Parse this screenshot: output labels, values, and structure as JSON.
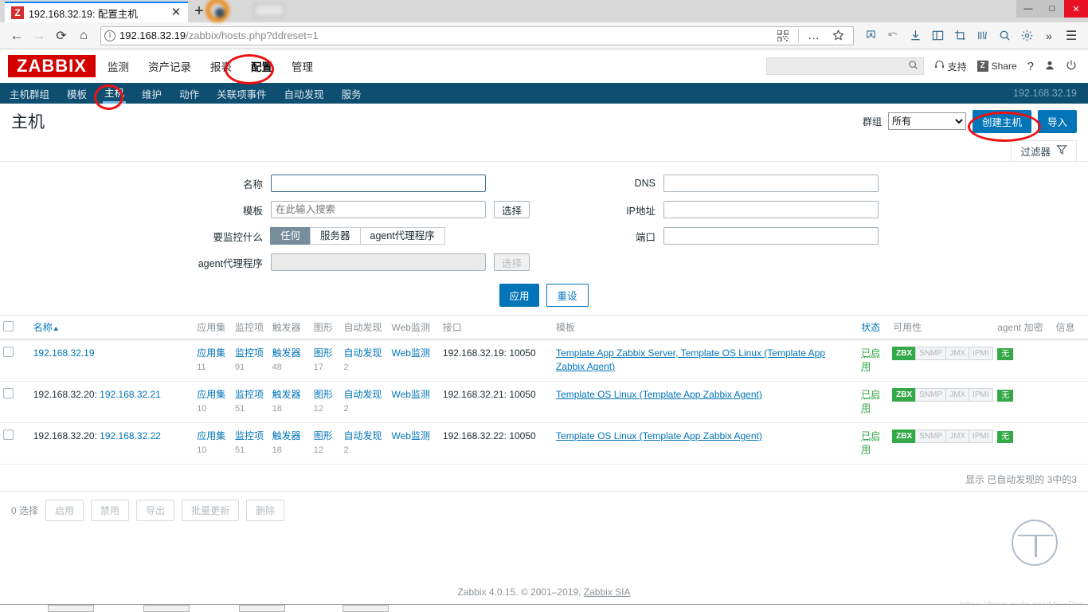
{
  "browser": {
    "tab": {
      "favicon_letter": "Z",
      "title": "192.168.32.19: 配置主机",
      "close": "✕"
    },
    "newtab_label": "+",
    "window_controls": {
      "minimize": "—",
      "maximize": "□",
      "close": "✕"
    },
    "nav": {
      "back": "←",
      "forward": "→",
      "reload": "⟳",
      "home": "⌂"
    },
    "url": {
      "scheme_host": "192.168.32.19",
      "path": "/zabbix/hosts.php?ddreset=1"
    },
    "toolbar_icons": [
      "qr-code-icon",
      "more-icon",
      "star-icon",
      "pocket-icon",
      "undo-icon",
      "download-icon",
      "sidebar-icon",
      "screenshot-icon",
      "library-icon",
      "search-icon",
      "settings-icon",
      "overflow-icon",
      "menu-icon"
    ]
  },
  "zabbix": {
    "logo": "ZABBIX",
    "main_menu": [
      {
        "label": "监测",
        "selected": false
      },
      {
        "label": "资产记录",
        "selected": false
      },
      {
        "label": "报表",
        "selected": false
      },
      {
        "label": "配置",
        "selected": true
      },
      {
        "label": "管理",
        "selected": false
      }
    ],
    "header_right": {
      "search_value": "",
      "support": "支持",
      "share": "Share",
      "share_badge": "Z",
      "help": "?",
      "user_icon": "user-icon",
      "signout_icon": "power-icon"
    },
    "sub_menu": [
      {
        "label": "主机群组",
        "selected": false
      },
      {
        "label": "模板",
        "selected": false
      },
      {
        "label": "主机",
        "selected": true
      },
      {
        "label": "维护",
        "selected": false
      },
      {
        "label": "动作",
        "selected": false
      },
      {
        "label": "关联项事件",
        "selected": false
      },
      {
        "label": "自动发现",
        "selected": false
      },
      {
        "label": "服务",
        "selected": false
      }
    ],
    "server_ip": "192.168.32.19"
  },
  "page": {
    "title": "主机",
    "group_label": "群组",
    "group_selected": "所有",
    "group_options": [
      "所有"
    ],
    "create_host_button": "创建主机",
    "import_button": "导入",
    "filter_tab_label": "过滤器"
  },
  "filter": {
    "left": {
      "name_label": "名称",
      "name_value": "",
      "template_label": "模板",
      "template_value": "",
      "template_placeholder": "在此输入搜索",
      "template_select_button": "选择",
      "monitored_by_label": "要监控什么",
      "monitored_by_options": [
        {
          "label": "任何",
          "selected": true
        },
        {
          "label": "服务器",
          "selected": false
        },
        {
          "label": "agent代理程序",
          "selected": false
        }
      ],
      "proxy_label": "agent代理程序",
      "proxy_value": "",
      "proxy_select_button": "选择"
    },
    "right": {
      "dns_label": "DNS",
      "dns_value": "",
      "ip_label": "IP地址",
      "ip_value": "",
      "port_label": "端口",
      "port_value": ""
    },
    "apply_button": "应用",
    "reset_button": "重设"
  },
  "table": {
    "columns": [
      "名称",
      "应用集",
      "监控项",
      "触发器",
      "图形",
      "自动发现",
      "Web监测",
      "接口",
      "模板",
      "状态",
      "可用性",
      "agent 加密",
      "信息"
    ],
    "sort_indicator": "▲",
    "rows": [
      {
        "checked": false,
        "prefix": "",
        "name": "192.168.32.19",
        "applications": {
          "label": "应用集",
          "count": "11"
        },
        "items": {
          "label": "监控项",
          "count": "91"
        },
        "triggers": {
          "label": "触发器",
          "count": "48"
        },
        "graphs": {
          "label": "图形",
          "count": "17"
        },
        "discovery": {
          "label": "自动发现",
          "count": "2"
        },
        "web": {
          "label": "Web监测",
          "count": ""
        },
        "interface": "192.168.32.19: 10050",
        "templates": "Template App Zabbix Server, Template OS Linux (Template App Zabbix Agent)",
        "status": "已启用",
        "availability": [
          {
            "label": "ZBX",
            "on": true
          },
          {
            "label": "SNMP",
            "on": false
          },
          {
            "label": "JMX",
            "on": false
          },
          {
            "label": "IPMI",
            "on": false
          }
        ],
        "encryption": "无",
        "info": ""
      },
      {
        "checked": false,
        "prefix": "192.168.32.20:",
        "name": "192.168.32.21",
        "applications": {
          "label": "应用集",
          "count": "10"
        },
        "items": {
          "label": "监控项",
          "count": "51"
        },
        "triggers": {
          "label": "触发器",
          "count": "18"
        },
        "graphs": {
          "label": "图形",
          "count": "12"
        },
        "discovery": {
          "label": "自动发现",
          "count": "2"
        },
        "web": {
          "label": "Web监测",
          "count": ""
        },
        "interface": "192.168.32.21: 10050",
        "templates": "Template OS Linux (Template App Zabbix Agent)",
        "status": "已启用",
        "availability": [
          {
            "label": "ZBX",
            "on": true
          },
          {
            "label": "SNMP",
            "on": false
          },
          {
            "label": "JMX",
            "on": false
          },
          {
            "label": "IPMI",
            "on": false
          }
        ],
        "encryption": "无",
        "info": ""
      },
      {
        "checked": false,
        "prefix": "192.168.32.20:",
        "name": "192.168.32.22",
        "applications": {
          "label": "应用集",
          "count": "10"
        },
        "items": {
          "label": "监控项",
          "count": "51"
        },
        "triggers": {
          "label": "触发器",
          "count": "18"
        },
        "graphs": {
          "label": "图形",
          "count": "12"
        },
        "discovery": {
          "label": "自动发现",
          "count": "2"
        },
        "web": {
          "label": "Web监测",
          "count": ""
        },
        "interface": "192.168.32.22: 10050",
        "templates": "Template OS Linux (Template App Zabbix Agent)",
        "status": "已启用",
        "availability": [
          {
            "label": "ZBX",
            "on": true
          },
          {
            "label": "SNMP",
            "on": false
          },
          {
            "label": "JMX",
            "on": false
          },
          {
            "label": "IPMI",
            "on": false
          }
        ],
        "encryption": "无",
        "info": ""
      }
    ],
    "paging": "显示 已自动发现的 3中的3"
  },
  "bulk": {
    "selected_text": "0 选择",
    "buttons": [
      "启用",
      "禁用",
      "导出",
      "批量更新",
      "删除"
    ]
  },
  "footer": {
    "text": "Zabbix 4.0.15. © 2001–2019, ",
    "link": "Zabbix SIA"
  },
  "watermark": "https://blog.csdn.net/MicePro",
  "colors": {
    "brand_red": "#d40000",
    "accent_blue": "#0275b8",
    "subnav_bg": "#0e4e71",
    "status_green": "#34a948",
    "annotation_red": "#ee1111"
  }
}
